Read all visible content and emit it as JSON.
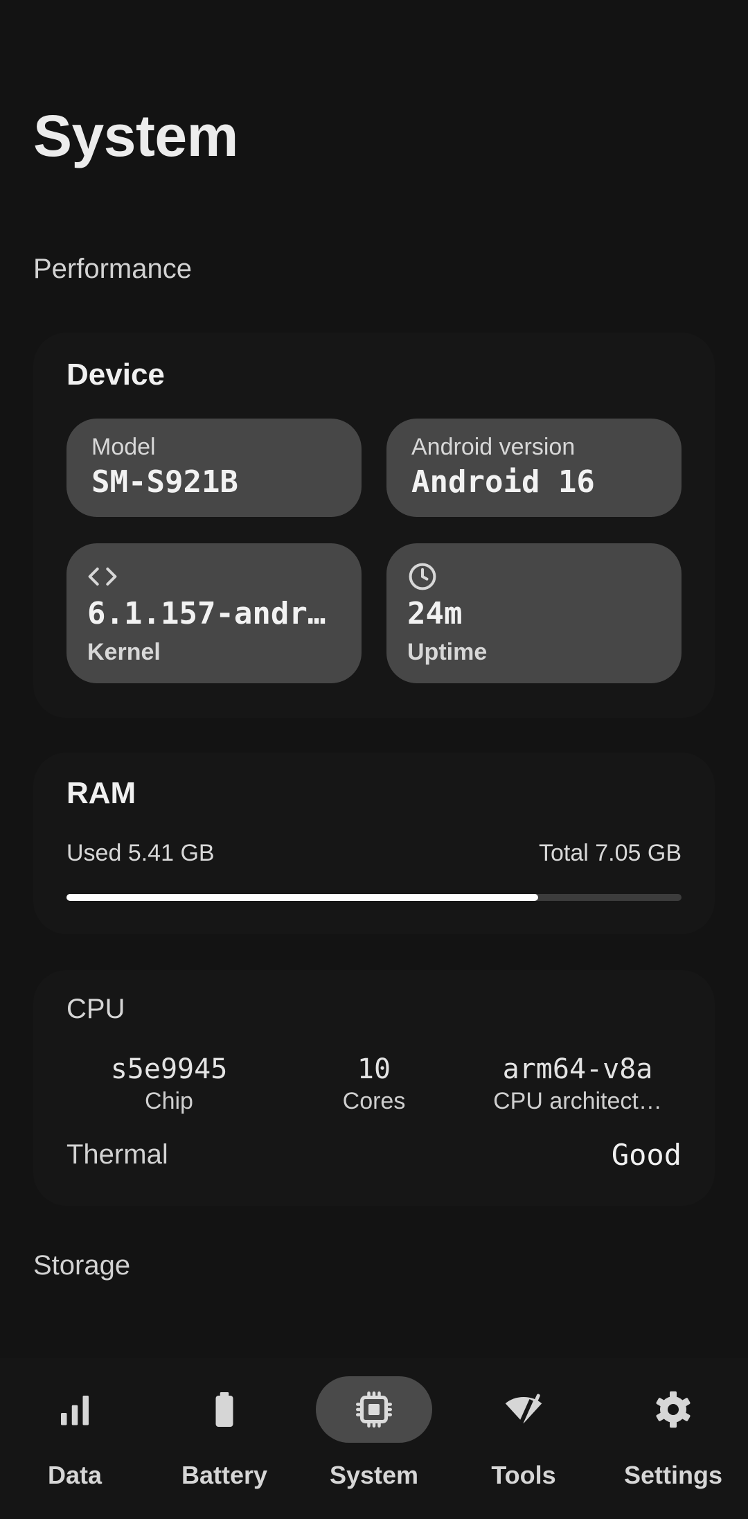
{
  "header": {
    "title": "System"
  },
  "sections": {
    "performance": "Performance",
    "storage": "Storage"
  },
  "device": {
    "title": "Device",
    "model": {
      "label": "Model",
      "value": "SM-S921B"
    },
    "android": {
      "label": "Android version",
      "value": "Android 16"
    },
    "kernel": {
      "label": "Kernel",
      "value": "6.1.157-andr…",
      "icon": "code-icon"
    },
    "uptime": {
      "label": "Uptime",
      "value": "24m",
      "icon": "clock-icon"
    }
  },
  "ram": {
    "title": "RAM",
    "used": "Used 5.41 GB",
    "total": "Total 7.05 GB",
    "used_fraction": 0.7674
  },
  "cpu": {
    "title": "CPU",
    "chip": {
      "value": "s5e9945",
      "label": "Chip"
    },
    "cores": {
      "value": "10",
      "label": "Cores"
    },
    "arch": {
      "value": "arm64-v8a",
      "label": "CPU architect…"
    },
    "thermal": {
      "label": "Thermal",
      "value": "Good"
    }
  },
  "nav": {
    "items": [
      {
        "label": "Data",
        "icon": "bar-chart-icon"
      },
      {
        "label": "Battery",
        "icon": "battery-icon"
      },
      {
        "label": "System",
        "icon": "chip-icon",
        "active": true
      },
      {
        "label": "Tools",
        "icon": "wifi-tools-icon"
      },
      {
        "label": "Settings",
        "icon": "gear-icon"
      }
    ]
  },
  "colors": {
    "background": "#131313",
    "tile": "#474747",
    "bar_fill": "#ffffff",
    "bar_track": "#3c3c3c",
    "nav_active": "#4a4a4a"
  }
}
